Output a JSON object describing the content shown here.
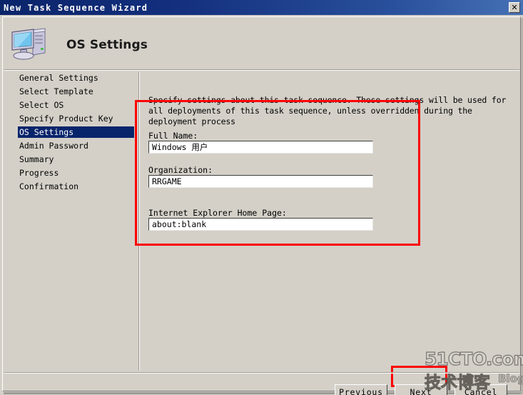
{
  "window": {
    "title": "New Task Sequence Wizard",
    "close_label": "✕",
    "titlebar_color": "#0a246a",
    "face_color": "#d4d0c8"
  },
  "header": {
    "title": "OS Settings",
    "icon": "computer-icon"
  },
  "sidebar": {
    "items": [
      {
        "label": "General Settings",
        "selected": false
      },
      {
        "label": "Select Template",
        "selected": false
      },
      {
        "label": "Select OS",
        "selected": false
      },
      {
        "label": "Specify Product Key",
        "selected": false
      },
      {
        "label": "OS Settings",
        "selected": true
      },
      {
        "label": "Admin Password",
        "selected": false
      },
      {
        "label": "Summary",
        "selected": false
      },
      {
        "label": "Progress",
        "selected": false
      },
      {
        "label": "Confirmation",
        "selected": false
      }
    ],
    "selected_color": "#08246b"
  },
  "content": {
    "description": "Specify settings about this task sequence.  These settings will be used for all deployments of this task sequence, unless overridden during the deployment process",
    "fields": [
      {
        "label": "Full Name:",
        "value": "Windows 用户",
        "placeholder": ""
      },
      {
        "label": "Organization:",
        "value": "RRGAME",
        "placeholder": ""
      },
      {
        "label": "Internet Explorer Home Page:",
        "value": "about:blank",
        "placeholder": ""
      }
    ]
  },
  "annotations": {
    "color": "#fe0000",
    "boxes": [
      {
        "name": "fields-highlight"
      },
      {
        "name": "next-button-highlight"
      }
    ]
  },
  "footer": {
    "buttons": [
      {
        "label": "Previous"
      },
      {
        "label": "Next"
      },
      {
        "label": "Cancel"
      }
    ]
  },
  "watermark": {
    "top": "51CTO.com",
    "chinese": "技术博客",
    "blog": "Blog"
  }
}
